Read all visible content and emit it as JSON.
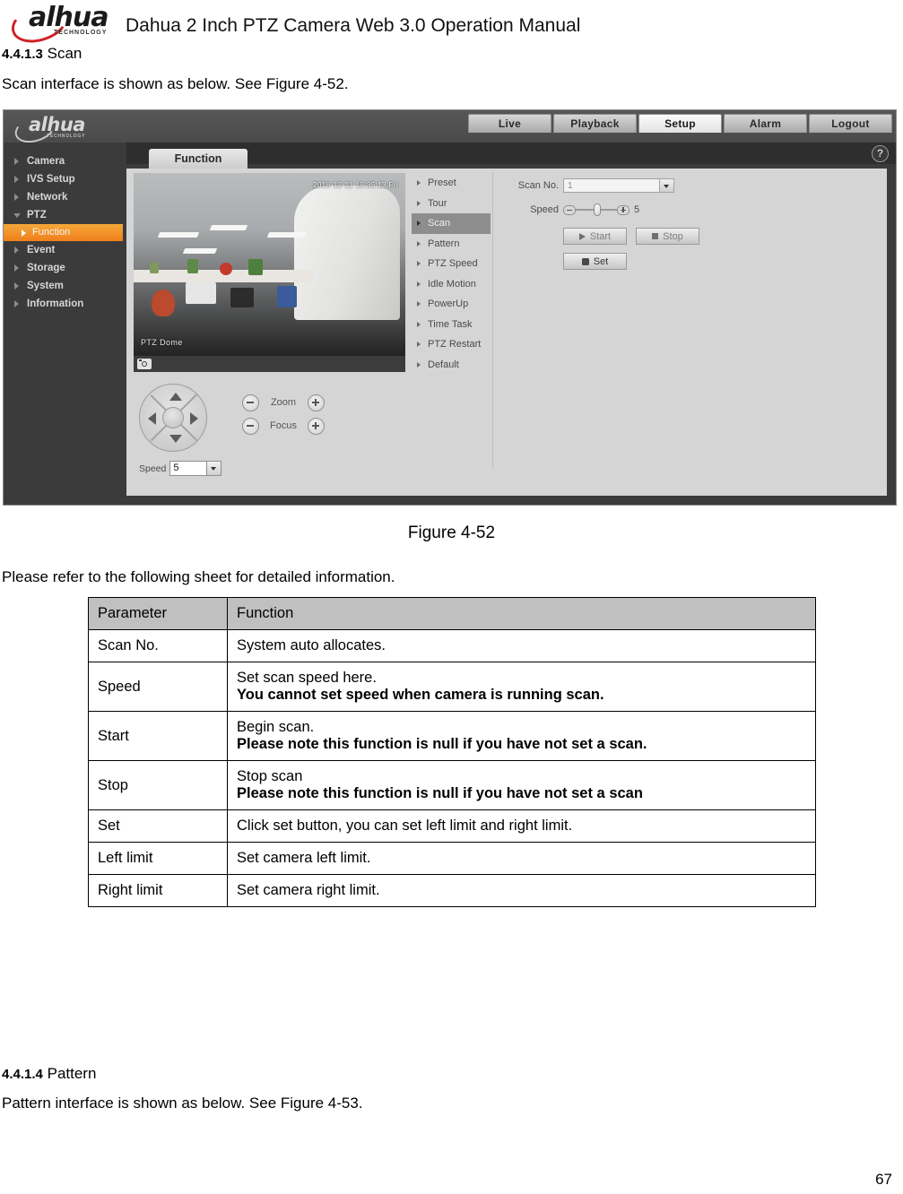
{
  "doc": {
    "brand": "alhua",
    "brand_sub": "TECHNOLOGY",
    "title": "Dahua 2 Inch PTZ Camera Web 3.0 Operation Manual",
    "page_number": "67"
  },
  "sections": {
    "scan": {
      "number": "4.4.1.3",
      "name": "Scan",
      "intro": "Scan interface is shown as below. See Figure 4-52."
    },
    "pattern": {
      "number": "4.4.1.4",
      "name": "Pattern",
      "intro": "Pattern interface is shown as below. See Figure 4-53."
    }
  },
  "figure": {
    "caption": "Figure 4-52"
  },
  "sheet_intro": "Please refer to the following sheet for detailed information.",
  "screenshot": {
    "brand": "alhua",
    "brand_sub": "TECHNOLOGY",
    "topnav": [
      {
        "label": "Live",
        "active": false
      },
      {
        "label": "Playback",
        "active": false
      },
      {
        "label": "Setup",
        "active": true
      },
      {
        "label": "Alarm",
        "active": false
      },
      {
        "label": "Logout",
        "active": false
      }
    ],
    "help_icon": "?",
    "sidebar": [
      {
        "label": "Camera",
        "state": "collapsed"
      },
      {
        "label": "IVS Setup",
        "state": "collapsed"
      },
      {
        "label": "Network",
        "state": "collapsed"
      },
      {
        "label": "PTZ",
        "state": "expanded"
      },
      {
        "label": "Function",
        "state": "selected-sub"
      },
      {
        "label": "Event",
        "state": "collapsed"
      },
      {
        "label": "Storage",
        "state": "collapsed"
      },
      {
        "label": "System",
        "state": "collapsed"
      },
      {
        "label": "Information",
        "state": "collapsed"
      }
    ],
    "tab": {
      "label": "Function"
    },
    "video": {
      "osd_timestamp": "2018-12-11 19:35:13 Fri",
      "channel_name": "PTZ Dome"
    },
    "function_list": [
      {
        "label": "Preset",
        "active": false
      },
      {
        "label": "Tour",
        "active": false
      },
      {
        "label": "Scan",
        "active": true
      },
      {
        "label": "Pattern",
        "active": false
      },
      {
        "label": "PTZ Speed",
        "active": false
      },
      {
        "label": "Idle Motion",
        "active": false
      },
      {
        "label": "PowerUp",
        "active": false
      },
      {
        "label": "Time Task",
        "active": false
      },
      {
        "label": "PTZ Restart",
        "active": false
      },
      {
        "label": "Default",
        "active": false
      }
    ],
    "form": {
      "scan_no_label": "Scan No.",
      "scan_no_value": "1",
      "speed_label": "Speed",
      "speed_value": "5",
      "start_label": "Start",
      "stop_label": "Stop",
      "set_label": "Set"
    },
    "ptz_control": {
      "zoom_label": "Zoom",
      "focus_label": "Focus",
      "speed_label": "Speed",
      "speed_value": "5"
    }
  },
  "table": {
    "headers": [
      "Parameter",
      "Function"
    ],
    "rows": [
      {
        "param": "Scan No.",
        "normal": "System auto allocates.",
        "bold": ""
      },
      {
        "param": "Speed",
        "normal": "Set scan speed here.",
        "bold": "You cannot set speed when camera is running scan."
      },
      {
        "param": "Start",
        "normal": "Begin scan.",
        "bold": "Please note this function is null if you have not set a scan."
      },
      {
        "param": "Stop",
        "normal": "Stop scan",
        "bold": "Please note this function is null if you have not set a scan"
      },
      {
        "param": "Set",
        "normal": "Click set button, you can set left limit and right limit.",
        "bold": ""
      },
      {
        "param": "Left limit",
        "normal": "Set camera left limit.",
        "bold": ""
      },
      {
        "param": "Right limit",
        "normal": "Set camera right limit.",
        "bold": ""
      }
    ]
  }
}
